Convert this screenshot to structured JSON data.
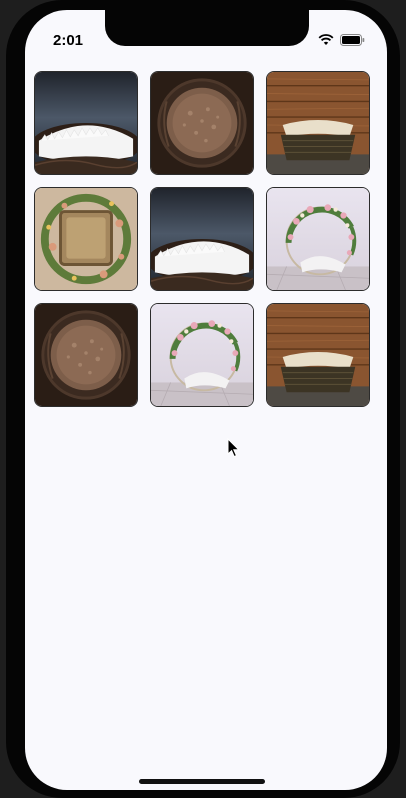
{
  "status_bar": {
    "time": "2:01",
    "icons": [
      "wifi-icon",
      "battery-icon"
    ]
  },
  "gallery": {
    "columns": 3,
    "items": [
      {
        "name": "fur-nest-dark-backdrop",
        "kind": "fur-nest"
      },
      {
        "name": "brown-fur-bowl",
        "kind": "brown-bowl"
      },
      {
        "name": "wicker-basket-wood-wall",
        "kind": "basket"
      },
      {
        "name": "floral-square-nest",
        "kind": "floral-square"
      },
      {
        "name": "fur-nest-dark-backdrop",
        "kind": "fur-nest"
      },
      {
        "name": "floral-hoop-white",
        "kind": "floral-hoop"
      },
      {
        "name": "brown-fur-bowl",
        "kind": "brown-bowl"
      },
      {
        "name": "floral-hoop-white",
        "kind": "floral-hoop"
      },
      {
        "name": "wicker-basket-wood-wall",
        "kind": "basket"
      }
    ]
  },
  "colors": {
    "background": "#f9f9fd",
    "tile_border": "#2c2c2c",
    "phone_frame": "#050505"
  }
}
